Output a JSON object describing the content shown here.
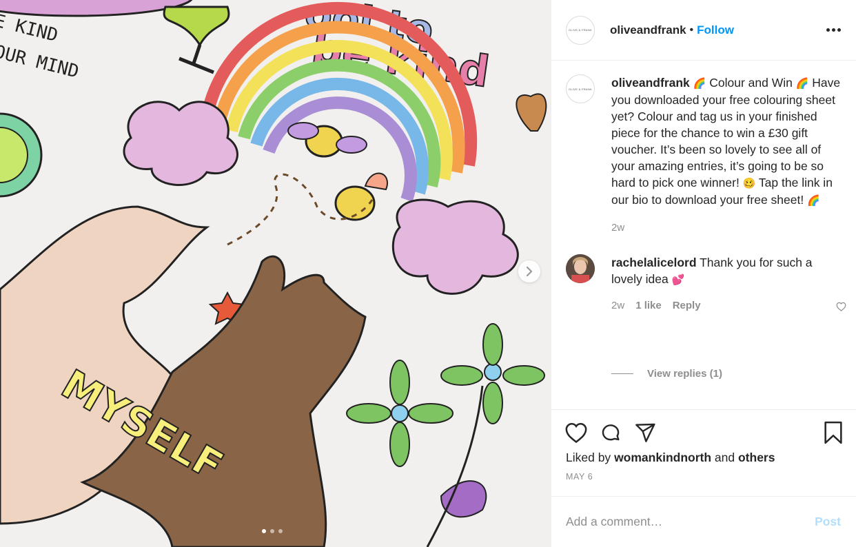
{
  "post": {
    "username": "oliveandfrank",
    "separator": "•",
    "follow_label": "Follow",
    "avatar_text": "OLIVE & FRANK",
    "more_icon": "more-options-icon"
  },
  "photo": {
    "carousel_dots": 3,
    "active_dot": 1,
    "next_icon": "chevron-right-icon"
  },
  "caption": {
    "username": "oliveandfrank",
    "emoji_rainbow": "🌈",
    "emoji_face": "🥴",
    "line_1": "Colour and Win",
    "line_2": "Have you downloaded your free colouring sheet yet? Colour and tag us in your finished piece for the chance to win a £30 gift voucher. It’s been so lovely to see all of your amazing entries, it’s going to be so hard to pick one winner!",
    "line_3": "Tap the link in our bio to download your free sheet!",
    "time": "2w"
  },
  "comment": {
    "username": "rachelalicelord",
    "text": "Thank you for such a lovely idea",
    "emoji": "💕",
    "time": "2w",
    "likes": "1 like",
    "reply_label": "Reply",
    "view_replies": "View replies (1)"
  },
  "actions": {
    "liked_prefix": "Liked by",
    "liked_user": "womankindnorth",
    "liked_and": "and",
    "liked_others": "others",
    "date": "MAY 6"
  },
  "add_comment": {
    "placeholder": "Add a comment…",
    "post_label": "Post"
  },
  "colors": {
    "accent": "#0095f6",
    "post_disabled": "#b2dffc",
    "text": "#262626",
    "muted": "#8e8e8e",
    "border": "#efefef"
  }
}
